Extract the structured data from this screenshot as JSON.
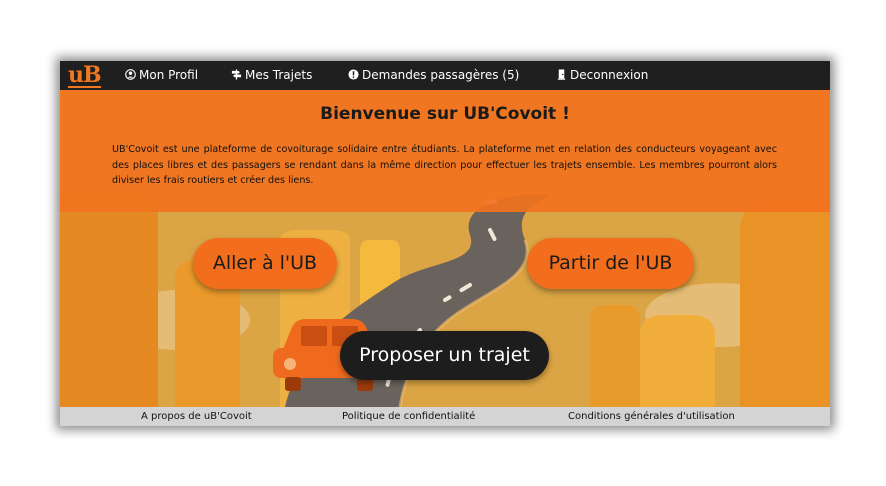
{
  "brand": {
    "logo_text": "uB"
  },
  "nav": {
    "profile": "Mon Profil",
    "trips": "Mes Trajets",
    "requests": "Demandes passagères (5)",
    "logout": "Deconnexion"
  },
  "banner": {
    "title": "Bienvenue sur UB'Covoit !",
    "text": "UB'Covoit est une plateforme de covoiturage solidaire entre étudiants. La plateforme met en relation des conducteurs voyageant avec des places libres et des passagers se rendant dans la même direction pour effectuer les trajets ensemble. Les membres pourront alors diviser les frais routiers et créer des liens."
  },
  "actions": {
    "go_to": "Aller à l'UB",
    "leave_from": "Partir de l'UB",
    "propose": "Proposer un trajet"
  },
  "footer": {
    "about": "A propos de uB'Covoit",
    "privacy": "Politique de confidentialité",
    "terms": "Conditions générales d'utilisation"
  },
  "colors": {
    "accent": "#f26d1c",
    "nav_bg": "#1f1f1f",
    "footer_bg": "#d4d4d4"
  }
}
